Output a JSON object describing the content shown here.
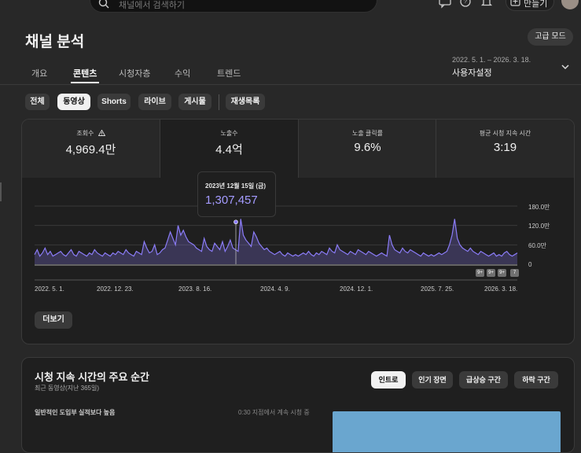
{
  "topbar": {
    "search_placeholder": "채널에서 검색하기",
    "create_label": "만들기"
  },
  "page": {
    "title": "채널 분석",
    "advanced_mode": "고급 모드",
    "date_range": "2022. 5. 1. – 2026. 3. 18.",
    "date_setting": "사용자설정"
  },
  "tabs": [
    "개요",
    "콘텐츠",
    "시청자층",
    "수익",
    "트렌드"
  ],
  "chips": [
    "전체",
    "동영상",
    "Shorts",
    "라이브",
    "게시물",
    "재생목록"
  ],
  "metrics": [
    {
      "label": "조회수",
      "value": "4,969.4만"
    },
    {
      "label": "노출수",
      "value": "4.4억"
    },
    {
      "label": "노출 클릭률",
      "value": "9.6%"
    },
    {
      "label": "평균 시청 지속 시간",
      "value": "3:19"
    }
  ],
  "tooltip": {
    "date": "2023년 12월 15일 (금)",
    "value": "1,307,457"
  },
  "chart_data": {
    "type": "line",
    "y_ticks": [
      "180.0만",
      "120.0만",
      "60.0만",
      "0"
    ],
    "x_ticks": [
      "2022. 5. 1.",
      "2022. 12. 23.",
      "2023. 8. 16.",
      "2024. 4. 9.",
      "2024. 12. 1.",
      "2025. 7. 25.",
      "2026. 3. 18."
    ],
    "ylim": [
      0,
      1800000
    ],
    "badges": [
      "9+",
      "9+",
      "9+",
      "7"
    ],
    "series": [
      {
        "color": "#8b7cf8",
        "values": [
          300000,
          450000,
          250000,
          350000,
          500000,
          300000,
          400000,
          250000,
          300000,
          350000,
          400000,
          300000,
          250000,
          350000,
          450000,
          300000,
          250000,
          400000,
          350000,
          300000,
          250000,
          350000,
          300000,
          450000,
          350000,
          300000,
          250000,
          350000,
          300000,
          250000,
          350000,
          300000,
          400000,
          350000,
          300000,
          450000,
          350000,
          300000,
          250000,
          400000,
          350000,
          300000,
          700000,
          500000,
          350000,
          400000,
          600000,
          300000,
          350000,
          450000,
          500000,
          750000,
          1000000,
          800000,
          600000,
          1200000,
          900000,
          1050000,
          850000,
          700000,
          650000,
          600000,
          500000,
          450000,
          400000,
          800000,
          550000,
          450000,
          400000,
          650000,
          550000,
          450000,
          700000,
          400000,
          550000,
          750000,
          500000,
          450000,
          400000,
          1400000,
          900000,
          750000,
          650000,
          550000,
          1000000,
          850000,
          650000,
          550000,
          450000,
          500000,
          400000,
          350000,
          300000,
          350000,
          400000,
          300000,
          250000,
          350000,
          300000,
          250000,
          300000,
          250000,
          300000,
          350000,
          300000,
          400000,
          300000,
          250000,
          350000,
          300000,
          400000,
          350000,
          300000,
          500000,
          400000,
          350000,
          600000,
          450000,
          400000,
          350000,
          300000,
          400000,
          350000,
          300000,
          450000,
          400000,
          350000,
          300000,
          400000,
          350000,
          300000,
          250000,
          300000,
          350000,
          300000,
          250000,
          900000,
          600000,
          450000,
          400000,
          350000,
          500000,
          400000,
          350000,
          450000,
          400000,
          350000,
          300000,
          250000,
          350000,
          300000,
          250000,
          300000,
          250000,
          300000,
          350000,
          300000,
          350000,
          400000,
          600000,
          900000,
          1400000,
          800000,
          600000,
          500000,
          450000,
          400000,
          500000,
          400000,
          350000,
          300000,
          400000,
          350000,
          300000,
          250000,
          300000,
          350000,
          250000,
          300000,
          250000,
          350000,
          400000,
          300000,
          250000,
          300000,
          350000
        ]
      }
    ]
  },
  "more_label": "더보기",
  "section2": {
    "title": "시청 지속 시간의 주요 순간",
    "subtitle": "최근 동영상(지난 365일)",
    "chips": [
      "인트로",
      "인기 장면",
      "급상승 구간",
      "하락 구간"
    ],
    "row_left": "일반적인 도입부 실적보다 높음",
    "row_right": "0:30 지점에서 계속 시청 중"
  }
}
